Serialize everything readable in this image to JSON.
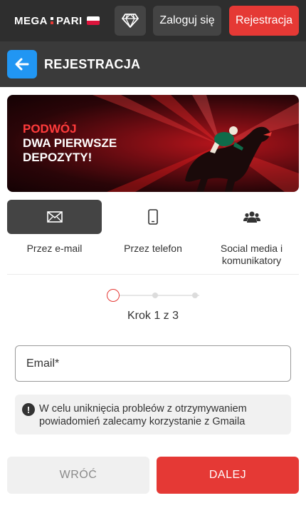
{
  "topbar": {
    "logo_left": "MEGA",
    "logo_right": "PARI",
    "login_label": "Zaloguj się",
    "register_label": "Rejestracja",
    "icons": {
      "gem": "diamond-icon",
      "flag": "poland-flag-icon"
    }
  },
  "header": {
    "title": "REJESTRACJA",
    "back_icon": "arrow-left-icon"
  },
  "banner": {
    "line1": "PODWÓJ",
    "line2": "DWA PIERWSZE",
    "line3": "DEPOZYTY!"
  },
  "tabs": [
    {
      "label": "Przez e-mail",
      "icon": "envelope-icon",
      "active": true
    },
    {
      "label": "Przez telefon",
      "icon": "phone-icon",
      "active": false
    },
    {
      "label": "Social media i komunikatory",
      "icon": "users-icon",
      "active": false
    }
  ],
  "stepper": {
    "text": "Krok 1 z 3",
    "current": 1,
    "total": 3
  },
  "form": {
    "email_label": "Email*"
  },
  "notice": {
    "text": "W celu uniknięcia probleów z otrzymywaniem powiadomień zalecamy korzystanie z Gmaila",
    "icon": "exclamation-circle-icon"
  },
  "actions": {
    "back_label": "WRÓĆ",
    "next_label": "DALEJ"
  },
  "colors": {
    "accent_red": "#e53935",
    "blue": "#2196f3",
    "dark": "#2e2e2e"
  }
}
